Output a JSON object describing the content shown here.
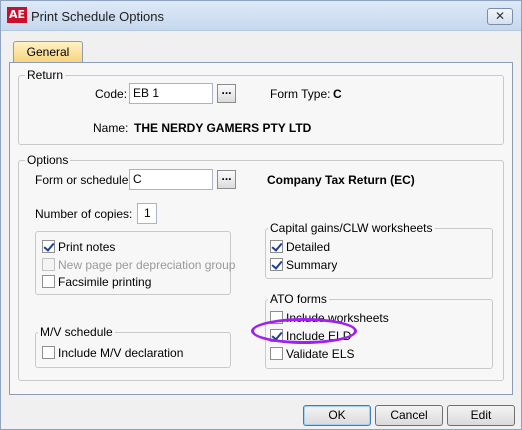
{
  "window": {
    "app_icon_text": "AE",
    "title": "Print Schedule Options",
    "close_glyph": "✕"
  },
  "tabs": [
    {
      "label": "General"
    }
  ],
  "return_group": {
    "legend": "Return",
    "code_label": "Code:",
    "code_value": "EB 1",
    "browse_label": "...",
    "form_type_label": "Form Type:",
    "form_type_value": "C",
    "name_label": "Name:",
    "name_value": "THE NERDY GAMERS PTY LTD"
  },
  "options_group": {
    "legend": "Options",
    "form_label": "Form or schedule:",
    "form_value": "C",
    "browse_label": "...",
    "form_description": "Company Tax Return (EC)",
    "copies_label": "Number of copies:",
    "copies_value": "1",
    "print_checks": [
      {
        "label": "Print notes",
        "checked": true,
        "disabled": false
      },
      {
        "label": "New page per depreciation group",
        "checked": false,
        "disabled": true
      },
      {
        "label": "Facsimile printing",
        "checked": false,
        "disabled": false
      }
    ],
    "capital_gains": {
      "legend": "Capital gains/CLW worksheets",
      "items": [
        {
          "label": "Detailed",
          "checked": true
        },
        {
          "label": "Summary",
          "checked": true
        }
      ]
    },
    "mv_schedule": {
      "legend": "M/V schedule",
      "items": [
        {
          "label": "Include M/V declaration",
          "checked": false
        }
      ]
    },
    "ato_forms": {
      "legend": "ATO forms",
      "items": [
        {
          "label": "Include worksheets",
          "checked": false
        },
        {
          "label": "Include ELD",
          "checked": true
        },
        {
          "label": "Validate ELS",
          "checked": false
        }
      ]
    }
  },
  "buttons": {
    "ok": "OK",
    "cancel": "Cancel",
    "edit": "Edit"
  },
  "colors": {
    "annotation_ellipse": "#a020f0",
    "tab_active": "#f7d27a"
  }
}
